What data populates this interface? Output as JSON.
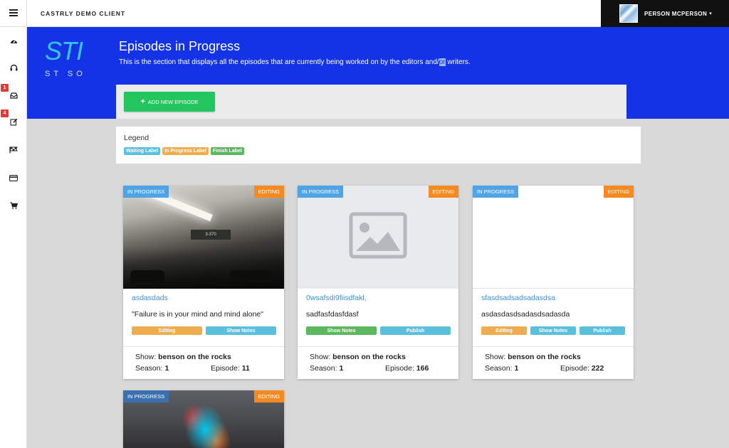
{
  "app": {
    "title": "CASTRLY DEMO CLIENT"
  },
  "user": {
    "name": "PERSON MCPERSON",
    "caret": "▾"
  },
  "sidebar": {
    "items": [
      {
        "icon": "dashboard-icon"
      },
      {
        "icon": "headphones-icon"
      },
      {
        "icon": "inbox-icon",
        "badge": "1"
      },
      {
        "icon": "edit-icon",
        "badge": "4"
      },
      {
        "icon": "flag-icon"
      },
      {
        "icon": "credit-card-icon"
      },
      {
        "icon": "cart-icon"
      }
    ]
  },
  "header": {
    "logo_text": "STI",
    "logo_sub": "ST SO",
    "title": "Episodes in Progress",
    "description_before": "This is the section that displays all the episodes that are currently being worked on by the editors and/",
    "description_highlight": "or",
    "description_after": " writers."
  },
  "actions": {
    "add_episode_label": "ADD NEW EPISODE",
    "add_icon": "+"
  },
  "legend": {
    "title": "Legend",
    "labels": [
      {
        "text": "Waiting Label",
        "color": "#5bc0de"
      },
      {
        "text": "In Progress Label",
        "color": "#f0ad4e"
      },
      {
        "text": "Finish Label",
        "color": "#5cb85c"
      }
    ]
  },
  "colors": {
    "header_bg": "#1433e6",
    "add_button": "#22c55e",
    "tag_in_progress": "#4ea4e6",
    "tag_editing": "#f48a21",
    "btn_editing": "#f0ad4e",
    "btn_show_notes": "#5bc0de",
    "btn_publish": "#5bc0de"
  },
  "episodes": [
    {
      "status": "IN PROGRESS",
      "stage": "EDITING",
      "title": "asdasdads",
      "description": "\"Failure is in your mind and mind alone\"",
      "buttons": [
        "Editing",
        "Show Notes"
      ],
      "show_label": "Show:",
      "show": "benson on the rocks",
      "season_label": "Season:",
      "season": "1",
      "episode_label": "Episode:",
      "episode": "11",
      "sign_text": "3-370"
    },
    {
      "status": "IN PROGRESS",
      "stage": "EDITING",
      "title": "0wsafsdi9fiisdfakl,",
      "description": "sadfasfdasfdasf",
      "buttons": [
        "Show Notes",
        "Publish"
      ],
      "show_label": "Show:",
      "show": "benson on the rocks",
      "season_label": "Season:",
      "season": "1",
      "episode_label": "Episode:",
      "episode": "166"
    },
    {
      "status": "IN PROGRESS",
      "stage": "EDITING",
      "title": "sfasdsadsadsadasdsa",
      "description": "asdasdasdsadasdsadasda",
      "buttons": [
        "Editing",
        "Show Notes",
        "Publish"
      ],
      "show_label": "Show:",
      "show": "benson on the rocks",
      "season_label": "Season:",
      "season": "1",
      "episode_label": "Episode:",
      "episode": "222"
    },
    {
      "status": "IN PROGRESS",
      "stage": "EDITING"
    }
  ]
}
